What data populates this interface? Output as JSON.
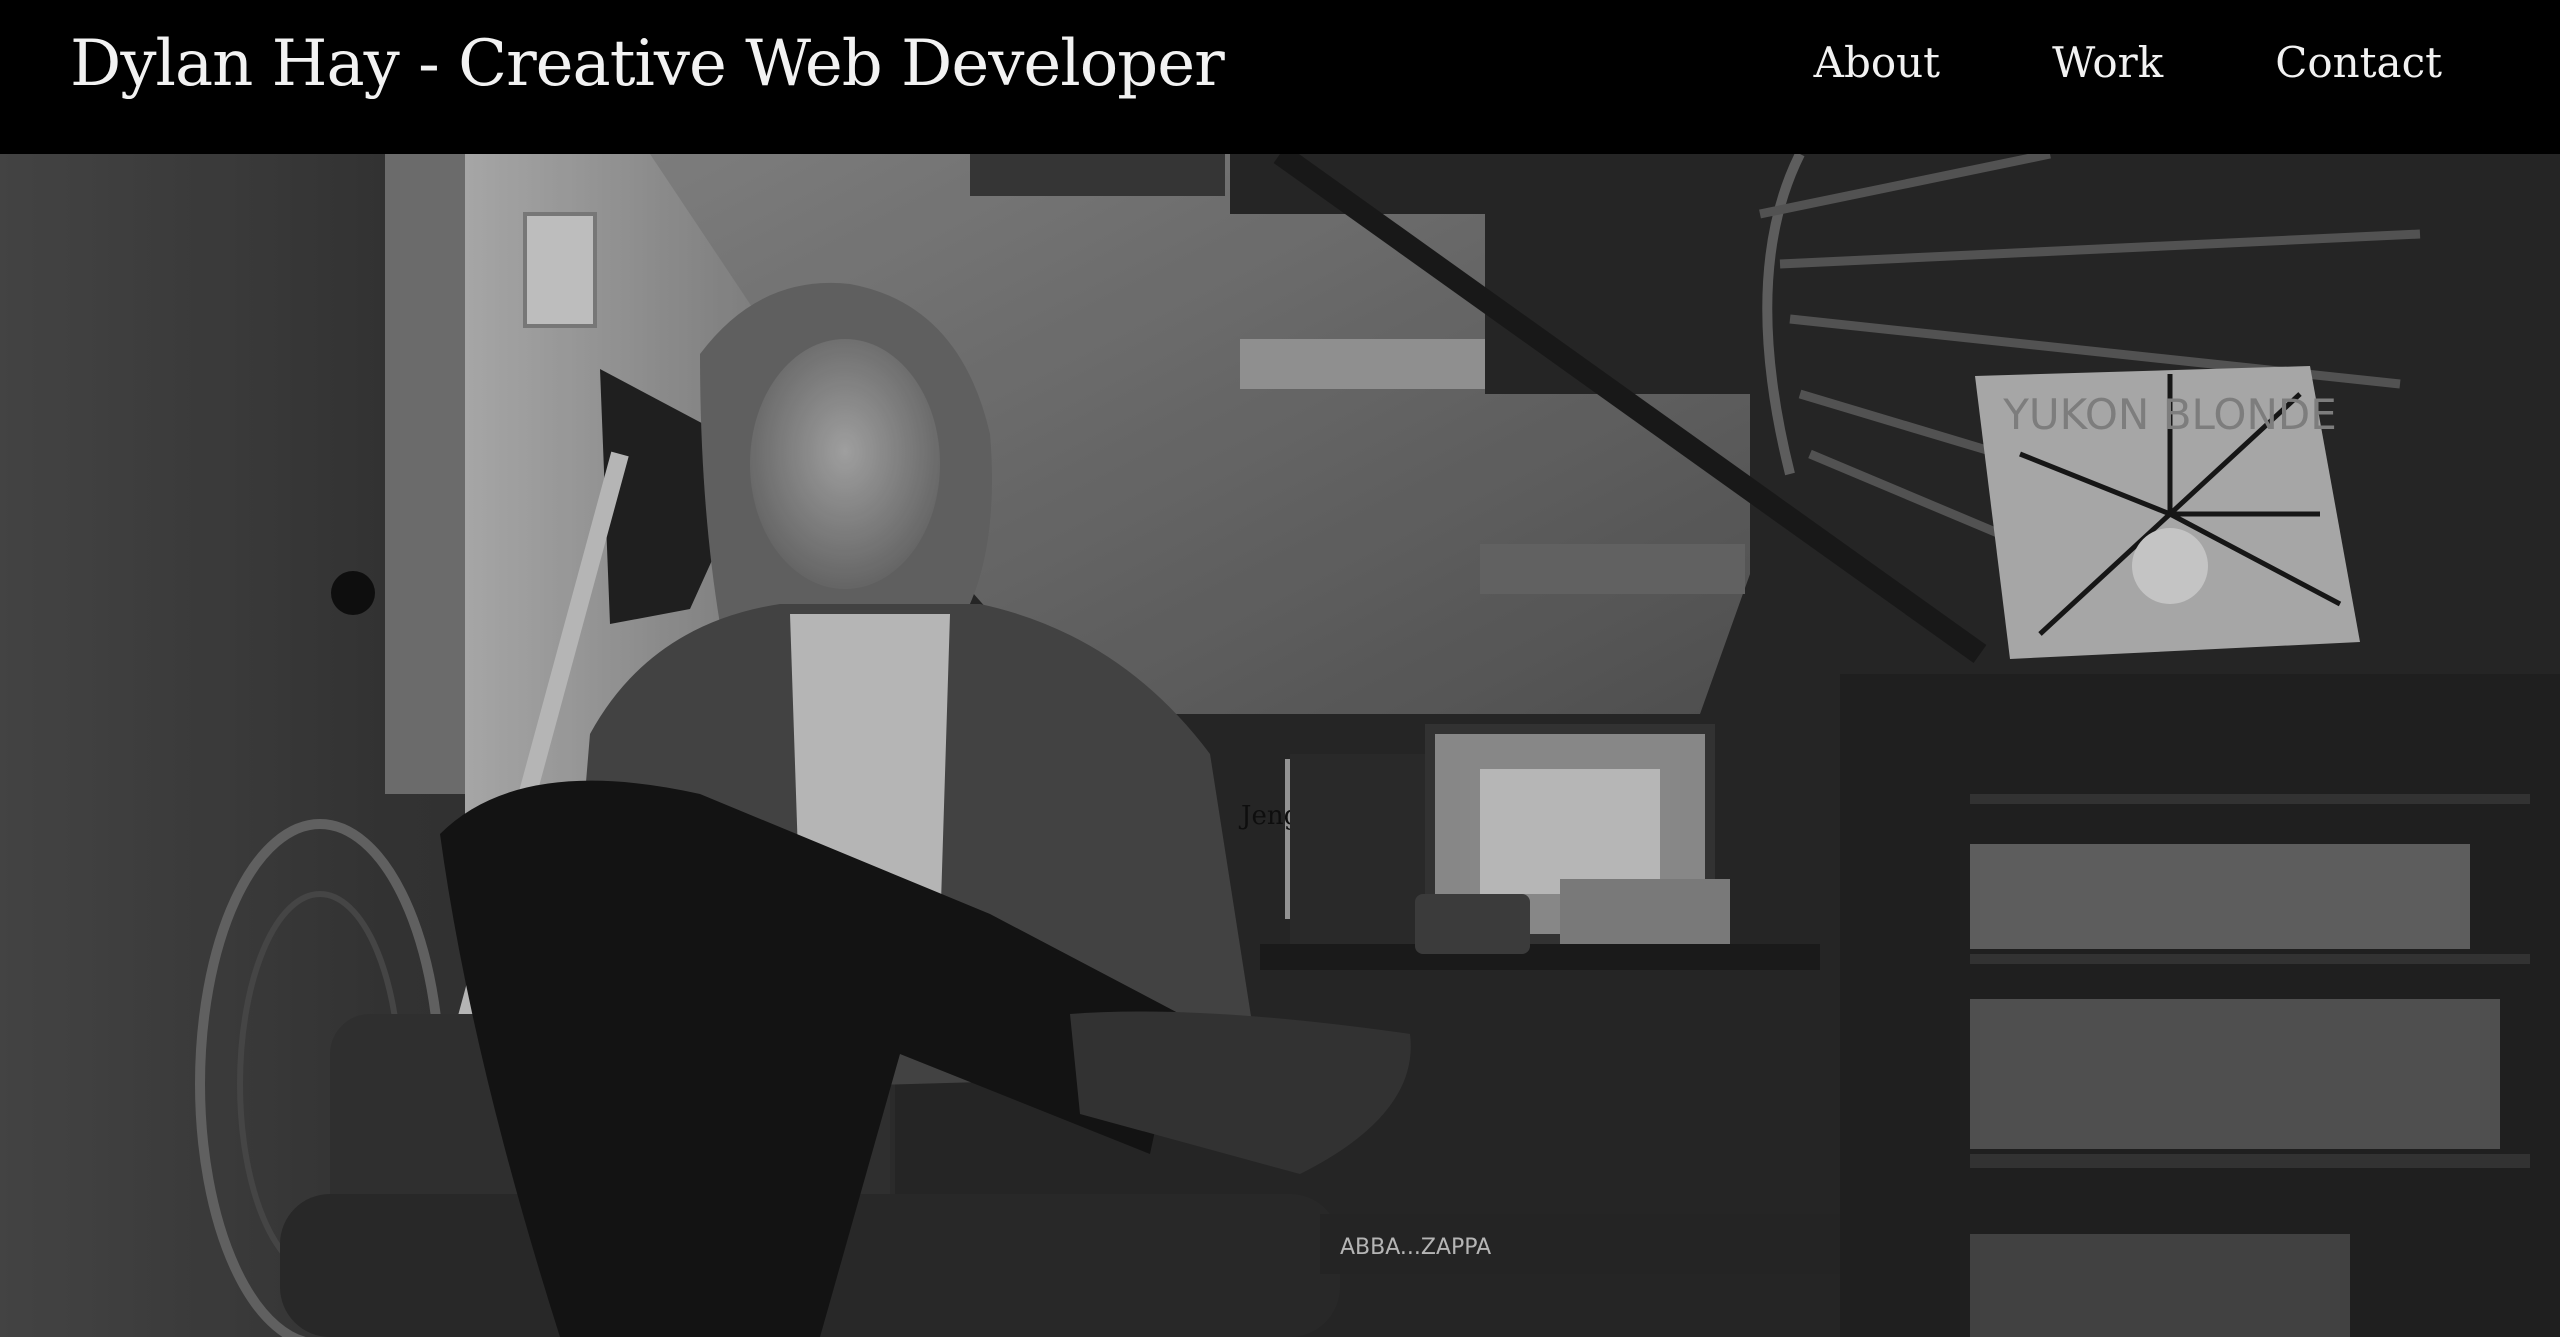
{
  "header": {
    "title": "Dylan Hay - Creative Web Developer"
  },
  "nav": {
    "items": [
      {
        "label": "About"
      },
      {
        "label": "Work"
      },
      {
        "label": "Contact"
      }
    ]
  },
  "hero": {
    "album_text": "YUKON BLONDE",
    "box_text": "Jenga Ultimate",
    "book_text": "ABBA...ZAPPA"
  },
  "colors": {
    "background": "#000000",
    "text": "#f2f2f2"
  }
}
